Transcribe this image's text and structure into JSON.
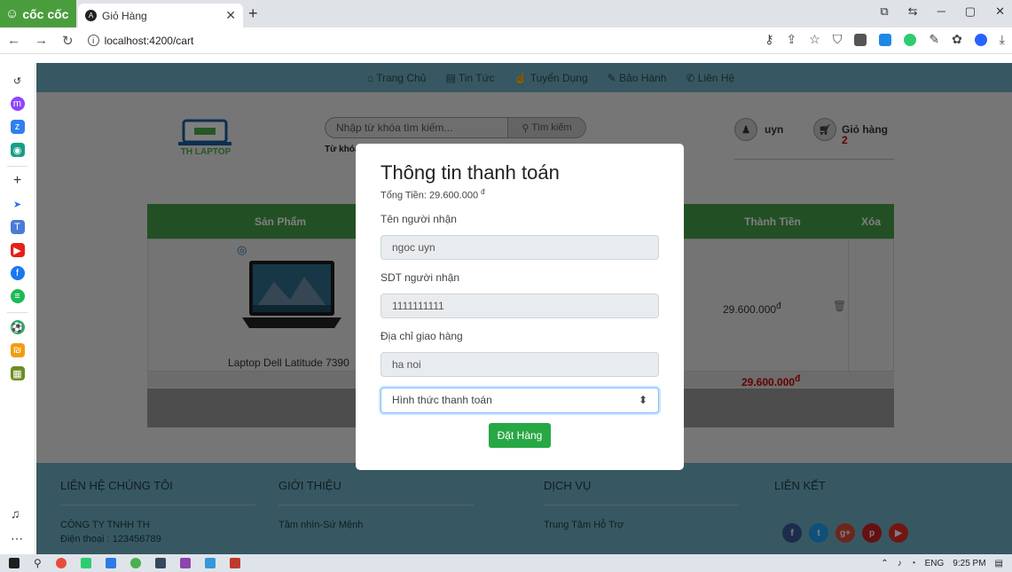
{
  "browser": {
    "brand": "cốc cốc",
    "tab_title": "Giỏ Hàng",
    "url": "localhost:4200/cart"
  },
  "site": {
    "nav": [
      {
        "icon": "home-icon",
        "label": "Trang Chủ"
      },
      {
        "icon": "newspaper-icon",
        "label": "Tin Tức"
      },
      {
        "icon": "thumbs-up-icon",
        "label": "Tuyển Dụng"
      },
      {
        "icon": "wrench-icon",
        "label": "Bảo Hành"
      },
      {
        "icon": "phone-icon",
        "label": "Liên Hệ"
      }
    ],
    "logo_text": "TH LAPTOP",
    "search_placeholder": "Nhập từ khóa tìm kiếm...",
    "search_button": "Tìm kiếm",
    "keyword_label": "Từ khóa",
    "username": "uyn",
    "cart_label": "Giỏ hàng",
    "cart_count": "2"
  },
  "cart": {
    "columns": [
      "Sản Phẩm",
      "Thành Tiền",
      "Xóa"
    ],
    "items": [
      {
        "name": "Laptop Dell Latitude 7390",
        "subtotal": "29.600.000",
        "currency": "đ"
      }
    ],
    "total": "29.600.000",
    "currency": "đ"
  },
  "modal": {
    "title": "Thông tin thanh toán",
    "total_label": "Tổng Tiền: 29.600.000",
    "currency": "đ",
    "recipient_label": "Tên người nhận",
    "recipient_value": "ngoc uyn",
    "phone_label": "SDT người nhận",
    "phone_value": "1111111111",
    "address_label": "Địa chỉ giao hàng",
    "address_value": "ha noi",
    "payment_placeholder": "Hình thức thanh toán",
    "order_button": "Đặt Hàng"
  },
  "footer": {
    "contact_heading": "LIÊN HỆ CHÚNG TÔI",
    "company": "CÔNG TY TNHH TH",
    "phone": "Điện thoại : 123456789",
    "about_heading": "GIỚI THIỆU",
    "about_item": "Tầm nhìn-Sứ Mệnh",
    "services_heading": "DỊCH VỤ",
    "services_item": "Trung Tâm Hỗ Trợ",
    "links_heading": "LIÊN KẾT"
  },
  "taskbar": {
    "lang": "ENG",
    "time": "9:25 PM"
  },
  "colors": {
    "nav_bg": "#6eb0c5",
    "table_header": "#45a049",
    "order_button": "#28a745",
    "total_text": "#cc0000"
  }
}
